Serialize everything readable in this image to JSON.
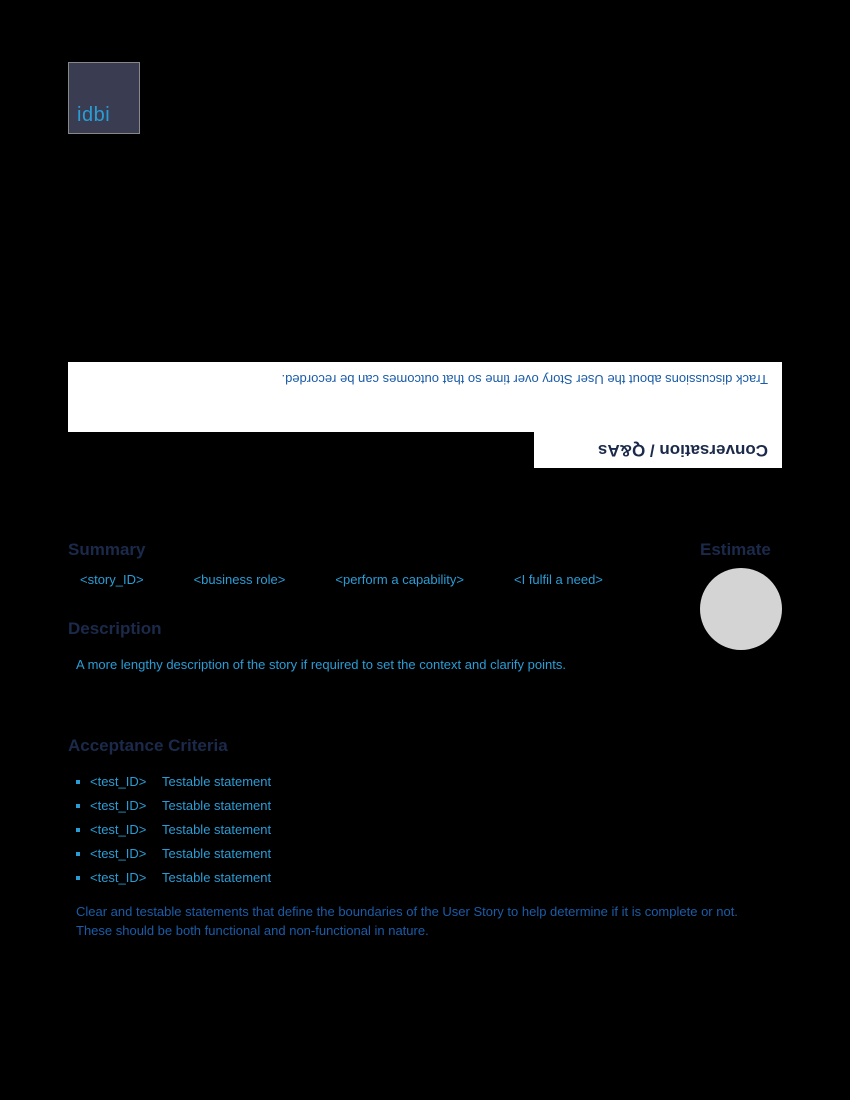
{
  "logo": {
    "text": "idbi"
  },
  "conversation": {
    "heading": "Conversation / Q&As",
    "help": "Track discussions about the User Story over time so that outcomes can be recorded."
  },
  "summary": {
    "heading": "Summary",
    "fields": {
      "story_id": "<story_ID>",
      "business_role": "<business role>",
      "capability": "<perform a capability>",
      "need": "<I fulfil a need>"
    }
  },
  "estimate": {
    "heading": "Estimate"
  },
  "description": {
    "heading": "Description",
    "text": "A more lengthy description of the story if required to set the context and clarify points."
  },
  "acceptance": {
    "heading": "Acceptance Criteria",
    "items": [
      {
        "id": "<test_ID>",
        "stmt": "Testable statement"
      },
      {
        "id": "<test_ID>",
        "stmt": "Testable statement"
      },
      {
        "id": "<test_ID>",
        "stmt": "Testable statement"
      },
      {
        "id": "<test_ID>",
        "stmt": "Testable statement"
      },
      {
        "id": "<test_ID>",
        "stmt": "Testable statement"
      }
    ],
    "help": "Clear and testable statements that define the boundaries of the User Story to help determine if it is complete or not. These should be both functional and non-functional in nature."
  }
}
